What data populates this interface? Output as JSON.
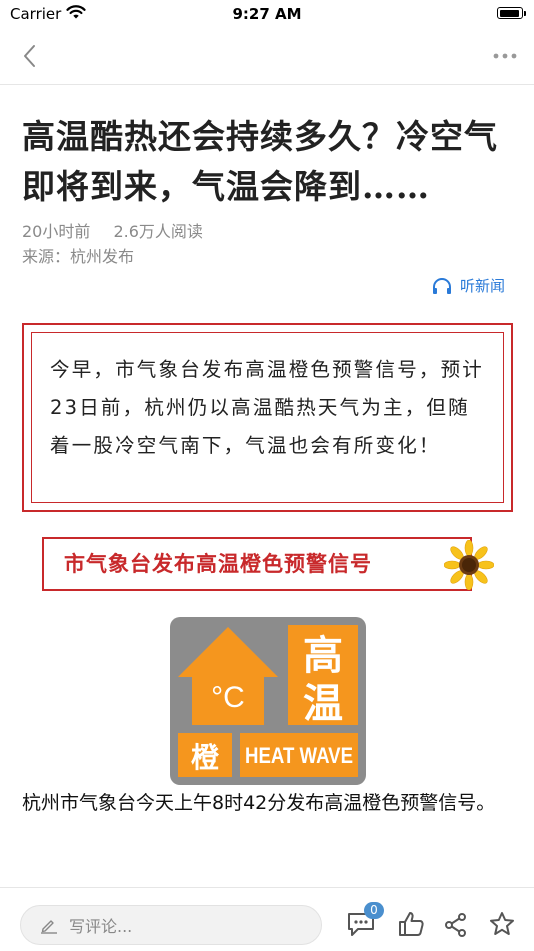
{
  "status_bar": {
    "carrier": "Carrier",
    "time": "9:27 AM"
  },
  "article": {
    "title": "高温酷热还会持续多久？冷空气即将到来，气温会降到……",
    "time_ago": "20小时前",
    "reads": "2.6万人阅读",
    "source": "来源：杭州发布",
    "listen_label": "听新闻",
    "summary": "今早，市气象台发布高温橙色预警信号，预计23日前，杭州仍以高温酷热天气为主，但随着一股冷空气南下，气温也会有所变化！",
    "banner": "市气象台发布高温橙色预警信号",
    "warning_icon": {
      "temp": "°C",
      "cn_top": "高",
      "cn_bottom": "温",
      "level_char": "橙",
      "en": "HEAT WAVE",
      "color": "#f5961e"
    },
    "caption": "杭州市气象台今天上午8时42分发布高温橙色预警信号。"
  },
  "bottom_bar": {
    "comment_placeholder": "写评论...",
    "comment_count": "0",
    "icons": [
      "comment-icon",
      "like-icon",
      "share-icon",
      "favorite-icon"
    ]
  },
  "colors": {
    "accent_red": "#c8292b",
    "link_blue": "#2a7ad8",
    "badge_blue": "#4a8fce"
  }
}
